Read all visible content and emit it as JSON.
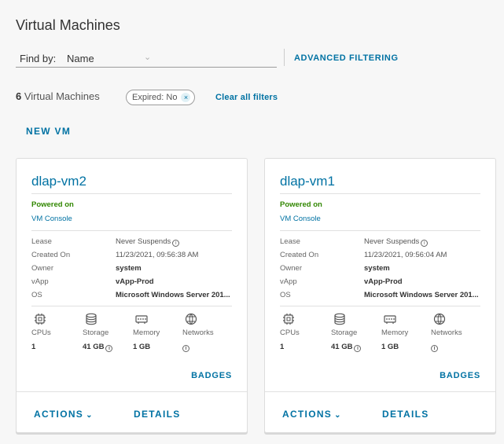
{
  "page": {
    "title": "Virtual Machines"
  },
  "filter": {
    "find_by_label": "Find by:",
    "find_by_value": "Name",
    "advanced_label": "ADVANCED FILTERING"
  },
  "summary": {
    "count": "6",
    "count_label": "Virtual Machines",
    "chip_label": "Expired: No",
    "clear_label": "Clear all filters"
  },
  "toolbar": {
    "new_vm_label": "NEW VM"
  },
  "labels": {
    "lease": "Lease",
    "created_on": "Created On",
    "owner": "Owner",
    "vapp": "vApp",
    "os": "OS",
    "cpus": "CPUs",
    "storage": "Storage",
    "memory": "Memory",
    "networks": "Networks",
    "badges": "BADGES",
    "actions": "ACTIONS",
    "details": "DETAILS",
    "info_glyph": "i",
    "chevron_glyph": "⌄",
    "close_glyph": "×"
  },
  "vms": [
    {
      "name": "dlap-vm2",
      "status": "Powered on",
      "console": "VM Console",
      "lease": "Never Suspends",
      "created_on": "11/23/2021, 09:56:38 AM",
      "owner": "system",
      "vapp": "vApp-Prod",
      "os": "Microsoft Windows Server 201...",
      "cpus": "1",
      "storage": "41 GB",
      "memory": "1 GB"
    },
    {
      "name": "dlap-vm1",
      "status": "Powered on",
      "console": "VM Console",
      "lease": "Never Suspends",
      "created_on": "11/23/2021, 09:56:04 AM",
      "owner": "system",
      "vapp": "vApp-Prod",
      "os": "Microsoft Windows Server 201...",
      "cpus": "1",
      "storage": "41 GB",
      "memory": "1 GB"
    }
  ],
  "icons": {
    "cpu": "cpu-icon",
    "storage": "storage-icon",
    "memory": "memory-icon",
    "network": "network-icon",
    "info": "info-icon",
    "close": "close-icon",
    "chevron": "chevron-down-icon"
  },
  "colors": {
    "accent": "#0072a3",
    "powered_on": "#318700",
    "background": "#f7f7f7"
  }
}
